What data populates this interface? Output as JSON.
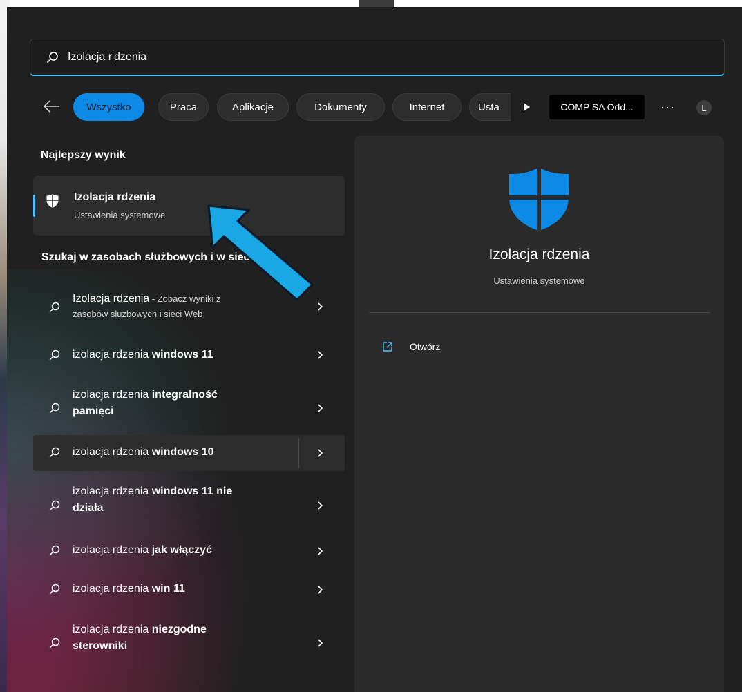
{
  "search": {
    "query_before_caret": "Izolacja r",
    "query_after_caret": "dzenia"
  },
  "filters": {
    "tabs": [
      {
        "label": "Wszystko",
        "active": true
      },
      {
        "label": "Praca"
      },
      {
        "label": "Aplikacje"
      },
      {
        "label": "Dokumenty"
      },
      {
        "label": "Internet"
      },
      {
        "label": "Usta"
      }
    ],
    "org_label": "COMP SA Odd...",
    "more_label": "···",
    "avatar_initial": "L"
  },
  "best_match": {
    "section_title": "Najlepszy wynik",
    "title": "Izolacja rdzenia",
    "subtitle": "Ustawienia systemowe"
  },
  "web_section": {
    "title": "Szukaj w zasobach służbowych i w sieci Web",
    "first": {
      "bold_lead": "Izolacja rdzenia",
      "suffix": " - Zobacz wyniki z",
      "line2": "zasobów służbowych i sieci Web"
    },
    "items": [
      {
        "base": "izolacja rdzenia ",
        "bold": "windows 11"
      },
      {
        "base": "izolacja rdzenia ",
        "bold": "integralność",
        "bold2": "pamięci"
      },
      {
        "base": "izolacja rdzenia ",
        "bold": "windows 10"
      },
      {
        "base": "izolacja rdzenia ",
        "bold": "windows 11 nie",
        "bold2": "działa"
      },
      {
        "base": "izolacja rdzenia ",
        "bold": "jak włączyć"
      },
      {
        "base": "izolacja rdzenia ",
        "bold": "win 11"
      },
      {
        "base": "izolacja rdzenia ",
        "bold": "niezgodne",
        "bold2": "sterowniki"
      }
    ]
  },
  "preview": {
    "title": "Izolacja rdzenia",
    "subtitle": "Ustawienia systemowe",
    "action_open": "Otwórz"
  },
  "colors": {
    "accent": "#4cc2ff",
    "active_pill": "#0c8ae6",
    "shield": "#0c8ae6",
    "callout_arrow": "#1aa7e6"
  }
}
